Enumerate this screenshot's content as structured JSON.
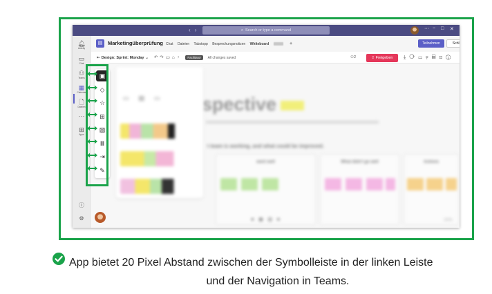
{
  "titlebar": {
    "nav": "‹ ›",
    "search_placeholder": "Search or type a command",
    "more": "···",
    "minimize": "−",
    "maximize": "□",
    "close": "✕"
  },
  "rail": {
    "items": [
      {
        "icon": "bell-icon",
        "glyph": "🔔",
        "label": "Activity"
      },
      {
        "icon": "chat-icon",
        "glyph": "💬",
        "label": "Chat"
      },
      {
        "icon": "teams-icon",
        "glyph": "👥",
        "label": "Teams"
      },
      {
        "icon": "calendar-icon",
        "glyph": "▦",
        "label": "Calendar"
      },
      {
        "icon": "files-icon",
        "glyph": "🗋",
        "label": "Dateien"
      },
      {
        "icon": "more-icon",
        "glyph": "···",
        "label": ""
      },
      {
        "icon": "apps-icon",
        "glyph": "⊞",
        "label": "Apps"
      }
    ],
    "help_glyph": "?",
    "settings_glyph": "⚙"
  },
  "header": {
    "app_title": "Marketingüberprüfung",
    "tabs": [
      "Chat",
      "Dateien",
      "Tabstopp",
      "Besprechungsnotizen",
      "Whiteboard"
    ],
    "active_tab": "Whiteboard",
    "join_label": "Teilnehmen",
    "close_label": "Schließen"
  },
  "board_toolbar": {
    "board_name": "Design: Sprint: Monday",
    "facilitator_label": "Facilitator",
    "saved_status": "All changes saved",
    "participant_count": "2",
    "share_label": "Freigeben"
  },
  "canvas": {
    "heading": "spective",
    "subheading": "t team is working, and what could be improved.",
    "columns": [
      {
        "title": "went well",
        "note_color": "#bfe6a4"
      },
      {
        "title": "What didn't go well",
        "note_color": "#f4b8e4"
      },
      {
        "title": "Actions",
        "note_color": "#f6d28c"
      }
    ],
    "zoom": "100%"
  },
  "shapes_toolbar": {
    "tools": [
      {
        "icon": "sticky-note-icon",
        "glyph": "▣",
        "active": true
      },
      {
        "icon": "shapes-icon",
        "glyph": "◇"
      },
      {
        "icon": "reaction-icon",
        "glyph": "☆"
      },
      {
        "icon": "table-icon",
        "glyph": "⊞"
      },
      {
        "icon": "image-icon",
        "glyph": "▨"
      },
      {
        "icon": "library-icon",
        "glyph": "𝍪"
      },
      {
        "icon": "import-icon",
        "glyph": "⇥"
      },
      {
        "icon": "pen-icon",
        "glyph": "✎"
      }
    ]
  },
  "caption": {
    "line1": "App bietet 20 Pixel Abstand zwischen der Symbolleiste in der linken Leiste",
    "line2": "und der Navigation in Teams."
  },
  "colors": {
    "highlight_green": "#1aa34a",
    "teams_purple": "#5b5fc7",
    "share_red": "#e5375a"
  }
}
